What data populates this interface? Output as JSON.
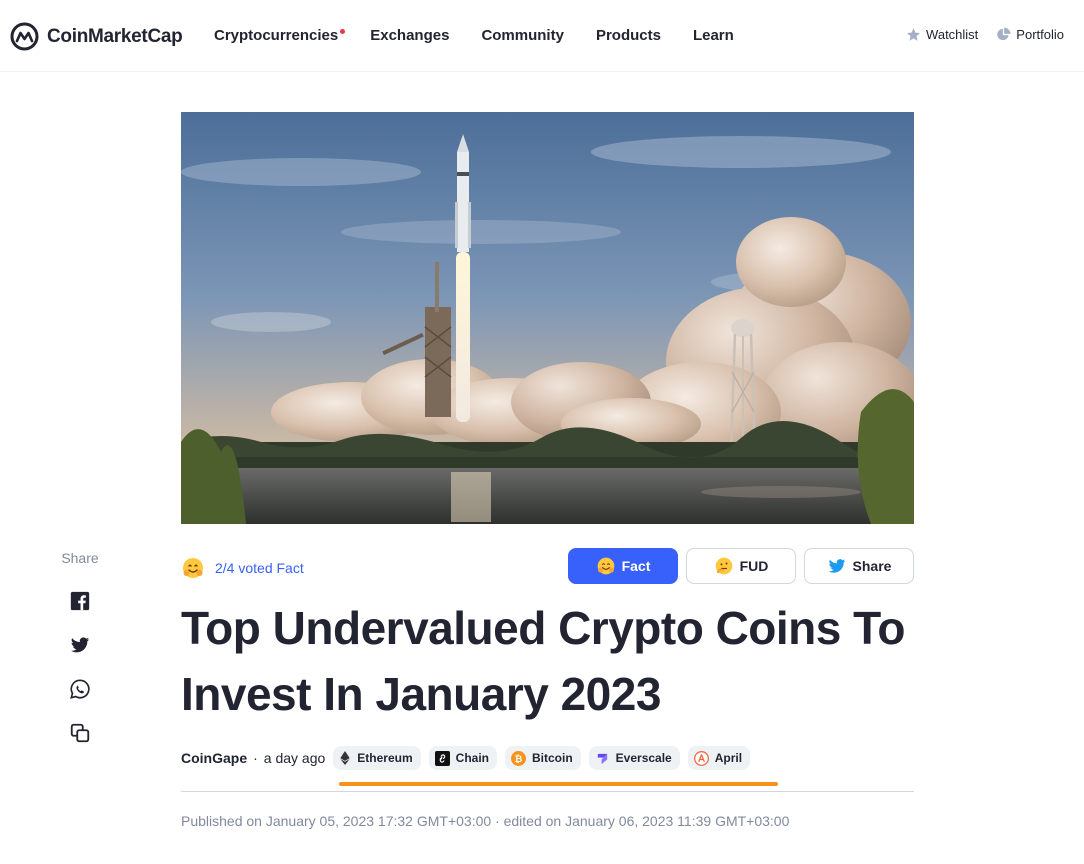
{
  "header": {
    "logo_text": "CoinMarketCap",
    "nav": [
      {
        "label": "Cryptocurrencies",
        "has_dot": true
      },
      {
        "label": "Exchanges"
      },
      {
        "label": "Community"
      },
      {
        "label": "Products"
      },
      {
        "label": "Learn"
      }
    ],
    "watchlist": "Watchlist",
    "portfolio": "Portfolio"
  },
  "hero": {
    "icon": "rocket-launch-photo"
  },
  "share_sidebar": {
    "label": "Share",
    "icons": [
      "facebook-icon",
      "twitter-icon",
      "whatsapp-icon",
      "copy-link-icon"
    ]
  },
  "vote": {
    "status": "2/4 voted Fact",
    "buttons": {
      "fact": "Fact",
      "fud": "FUD",
      "share": "Share"
    }
  },
  "article": {
    "title": "Top Undervalued Crypto Coins To Invest In January 2023",
    "source": "CoinGape",
    "separator": "·",
    "time_ago": "a day ago",
    "tags": [
      "Ethereum",
      "Chain",
      "Bitcoin",
      "Everscale",
      "April"
    ],
    "published": "Published on January 05, 2023 17:32 GMT+03:00 · edited on January 06, 2023 11:39 GMT+03:00"
  },
  "colors": {
    "accent": "#3861fb",
    "text": "#222531",
    "muted": "#808a9d",
    "progress": "#f7931a",
    "badge_red": "#ea3943"
  }
}
